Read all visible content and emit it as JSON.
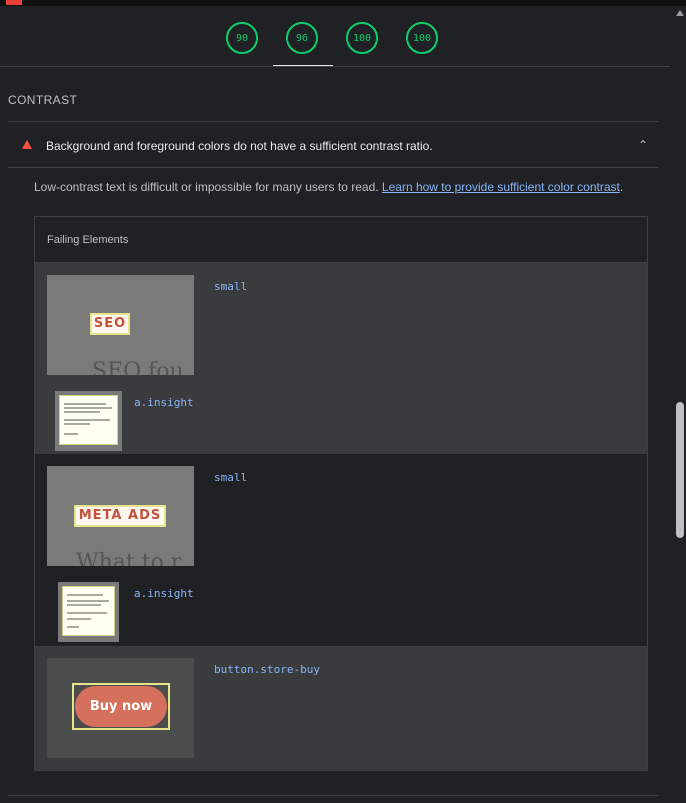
{
  "scores": [
    "90",
    "96",
    "100",
    "100"
  ],
  "section": {
    "title": "CONTRAST"
  },
  "audit": {
    "title": "Background and foreground colors do not have a sufficient contrast ratio.",
    "description": "Low-contrast text is difficult or impossible for many users to read. ",
    "link": "Learn how to provide sufficient color contrast",
    "period": "."
  },
  "table": {
    "header": "Failing Elements",
    "items": [
      {
        "selector": "small",
        "snippet_text": "SEO",
        "ghost_text": "SEO fou",
        "sub_selector": "a.insight"
      },
      {
        "selector": "small",
        "snippet_text": "META ADS",
        "ghost_text": "What to r",
        "sub_selector": "a.insight"
      },
      {
        "selector": "button.store-buy",
        "snippet_text": "Buy now"
      }
    ]
  },
  "colors": {
    "pass": "#0cce6b",
    "fail": "#ff4e42",
    "link": "#8ab4f8",
    "bg": "#202124"
  }
}
